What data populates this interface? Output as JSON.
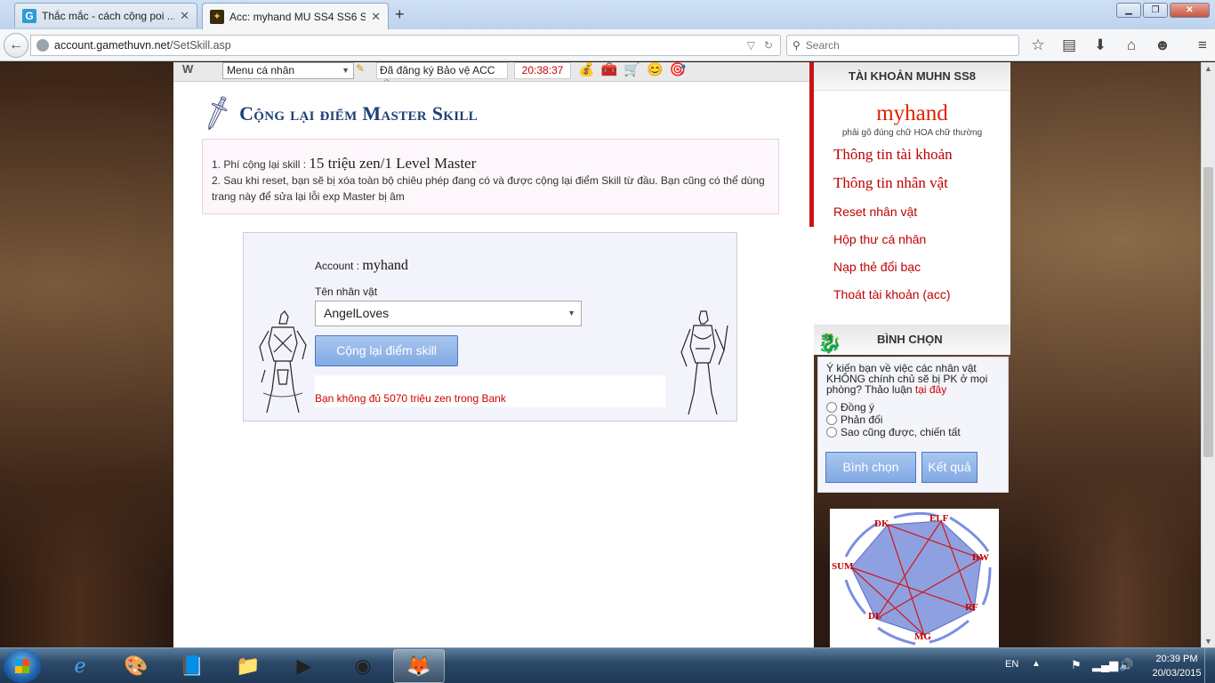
{
  "browser": {
    "tabs": [
      {
        "title": "Thắc mắc - cách cộng poi ...",
        "active": false
      },
      {
        "title": "Acc: myhand MU SS4 SS6 S...",
        "active": true
      }
    ],
    "new_tab": "+",
    "url_host": "account.gamethuvn.net",
    "url_path": "/SetSkill.asp",
    "search_placeholder": "Search"
  },
  "topstrip": {
    "menu_select": "Menu cá nhân",
    "protect_text": "Đã đăng ký Bảo vệ ACC",
    "clock": "20:38:37"
  },
  "page": {
    "title": "Cộng lại điểm Master Skill",
    "notice": {
      "line1_label": "1. Phí cộng lại skill : ",
      "line1_value": "15 triệu zen/1 Level Master",
      "line2": "2. Sau khi reset, bạn sẽ bị xóa toàn bộ chiêu phép đang có và được cộng lại điểm Skill từ đầu. Bạn cũng có thể dùng trang này để sửa lại lỗi exp Master bị âm"
    },
    "form": {
      "account_label": "Account : ",
      "account_value": "myhand",
      "char_label": "Tên nhân vật",
      "char_selected": "AngelLoves",
      "submit_label": "Cộng lại điểm skill",
      "error": "Bạn không đủ 5070 triệu zen trong Bank"
    }
  },
  "sidebar": {
    "header": "TÀI KHOẢN MUHN SS8",
    "username": "myhand",
    "hint": "phải gõ đúng chữ HOA chữ thường",
    "links": [
      "Thông tin tài khoản",
      "Thông tin nhân vật",
      "Reset nhân vật",
      "Hộp thư cá nhân",
      "Nạp thẻ đổi bạc",
      "Thoát tài khoản (acc)"
    ],
    "vote": {
      "header": "BÌNH CHỌN",
      "question": "Ý kiến bạn về việc các nhân vật KHÔNG chính chủ sẽ bị PK ở mọi phòng? Thảo luận ",
      "question_link": "tại đây",
      "options": [
        "Đồng ý",
        "Phản đối",
        "Sao cũng được, chiến tất"
      ],
      "vote_button": "Bình chọn",
      "result_button": "Kết quả"
    },
    "classes": [
      "DK",
      "ELF",
      "DW",
      "RF",
      "MG",
      "DL",
      "SUM"
    ]
  },
  "taskbar": {
    "lang": "EN",
    "time": "20:39 PM",
    "date": "20/03/2015"
  }
}
